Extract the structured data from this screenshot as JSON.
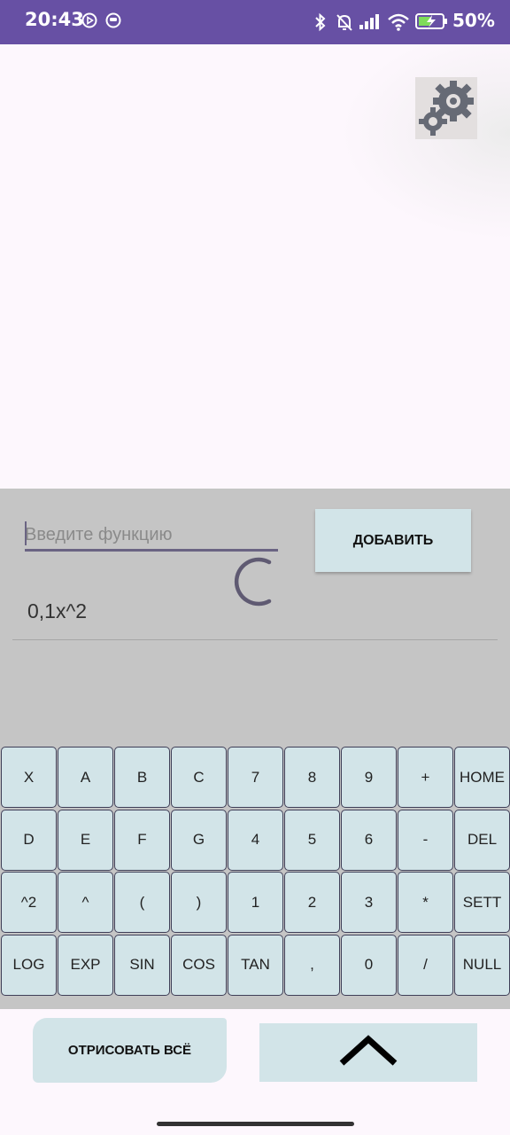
{
  "status_bar": {
    "time": "20:43",
    "battery": "50%",
    "icons": [
      "play-circle-icon",
      "face-icon",
      "bluetooth-icon",
      "mute-icon",
      "signal-icon",
      "wifi-icon",
      "battery-charging-icon"
    ]
  },
  "graph": {
    "settings_icon": "gears-icon"
  },
  "input": {
    "placeholder": "Введите функцию",
    "value": ""
  },
  "add_button": "ДОБАВИТЬ",
  "functions": [
    "0,1x^2"
  ],
  "keyboard": {
    "rows": [
      [
        "X",
        "A",
        "B",
        "C",
        "7",
        "8",
        "9",
        "+",
        "HOME"
      ],
      [
        "D",
        "E",
        "F",
        "G",
        "4",
        "5",
        "6",
        "-",
        "DEL"
      ],
      [
        "^2",
        "^",
        "(",
        ")",
        "1",
        "2",
        "3",
        "*",
        "SETT"
      ],
      [
        "LOG",
        "EXP",
        "SIN",
        "COS",
        "TAN",
        ",",
        "0",
        "/",
        "NULL"
      ]
    ]
  },
  "draw_all_button": "ОТРИСОВАТЬ ВСЁ",
  "collapse_button_icon": "chevron-up-icon",
  "colors": {
    "status_bar": "#6750a4",
    "panel": "#c5c5c5",
    "key": "#d2e4e8",
    "key_border": "#3f3f58",
    "background": "#fdf7fd"
  }
}
